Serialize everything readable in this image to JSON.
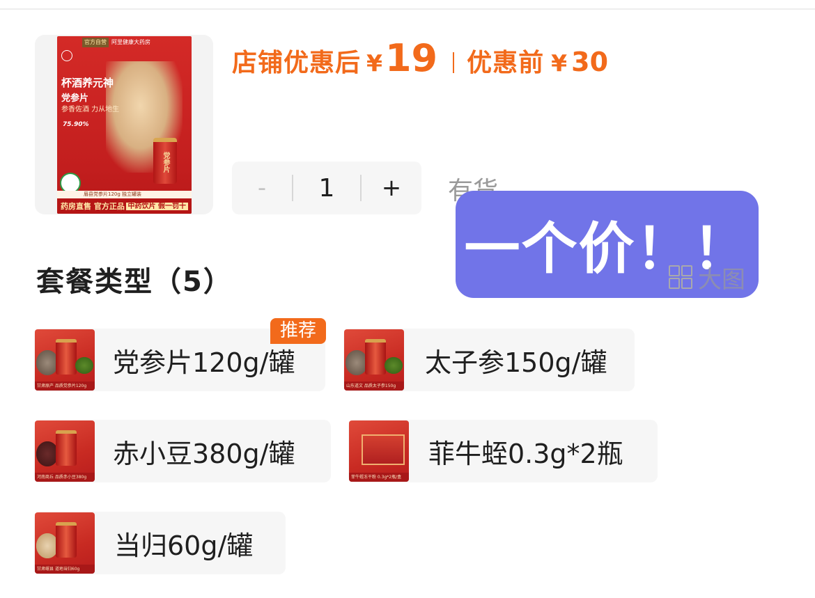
{
  "product": {
    "image": {
      "top_badges": [
        "官方自营",
        "阿里健康大药房"
      ],
      "title": "杯酒养元神",
      "subtitle": "党参片",
      "slogan": "参香佐酒 力从地生",
      "stat": "75.90%",
      "jar_label": "党参片",
      "band": "眉县党参片120g 独立罐装",
      "bottom_left": "药房直售 官方正品",
      "bottom_right": "中药饮片 假一罚十"
    }
  },
  "price": {
    "after_label": "店铺优惠后",
    "after_currency": "¥",
    "after_value": "19",
    "before_label": "优惠前",
    "before_currency": "¥",
    "before_value": "30",
    "accent_color": "#f26a1b"
  },
  "quantity": {
    "minus": "-",
    "value": "1",
    "plus": "+",
    "stock_status": "有货"
  },
  "overlay": {
    "text": "一个价！！",
    "color": "#7174e8"
  },
  "section": {
    "title": "套餐类型（5）",
    "big_view_label": "大图"
  },
  "options": [
    {
      "label": "党参片120g/罐",
      "tag": "推荐",
      "thumb_band": "甘肃原产 品质党参片120g"
    },
    {
      "label": "太子参150g/罐",
      "thumb_band": "山东道文 品质太子参150g"
    },
    {
      "label": "赤小豆380g/罐",
      "thumb_band": "河南商丘 品质赤小豆380g"
    },
    {
      "label": "菲牛蛭0.3g*2瓶",
      "thumb_band": "菲牛蛭冻干粉 0.3g*2瓶/盒"
    },
    {
      "label": "当归60g/罐",
      "thumb_band": "甘肃岷县 道地当归60g"
    }
  ]
}
